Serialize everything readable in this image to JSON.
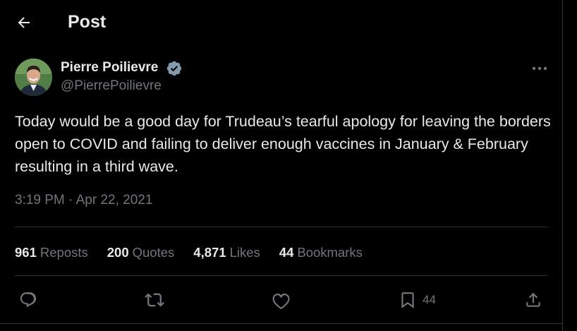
{
  "header": {
    "title": "Post",
    "back_icon": "arrow-left-icon"
  },
  "post": {
    "author": {
      "name": "Pierre Poilievre",
      "handle": "@PierrePoilievre",
      "verified": true,
      "verified_icon": "verified-badge-icon",
      "verified_color": "#829aab"
    },
    "text": "Today would be a good day for Trudeau’s tearful apology for leaving the borders open to COVID and failing to deliver enough vaccines in January & February resulting in a third wave.",
    "timestamp": "3:19 PM · Apr 22, 2021",
    "stats": [
      {
        "count": "961",
        "label": "Reposts"
      },
      {
        "count": "200",
        "label": "Quotes"
      },
      {
        "count": "4,871",
        "label": "Likes"
      },
      {
        "count": "44",
        "label": "Bookmarks"
      }
    ],
    "actions": {
      "reply_icon": "reply-icon",
      "repost_icon": "repost-icon",
      "like_icon": "heart-icon",
      "bookmark_icon": "bookmark-icon",
      "bookmark_count": "44",
      "share_icon": "share-icon"
    }
  },
  "colors": {
    "background": "#000000",
    "text_primary": "#e7e9ea",
    "text_secondary": "#71767b",
    "divider": "#2f3336"
  }
}
